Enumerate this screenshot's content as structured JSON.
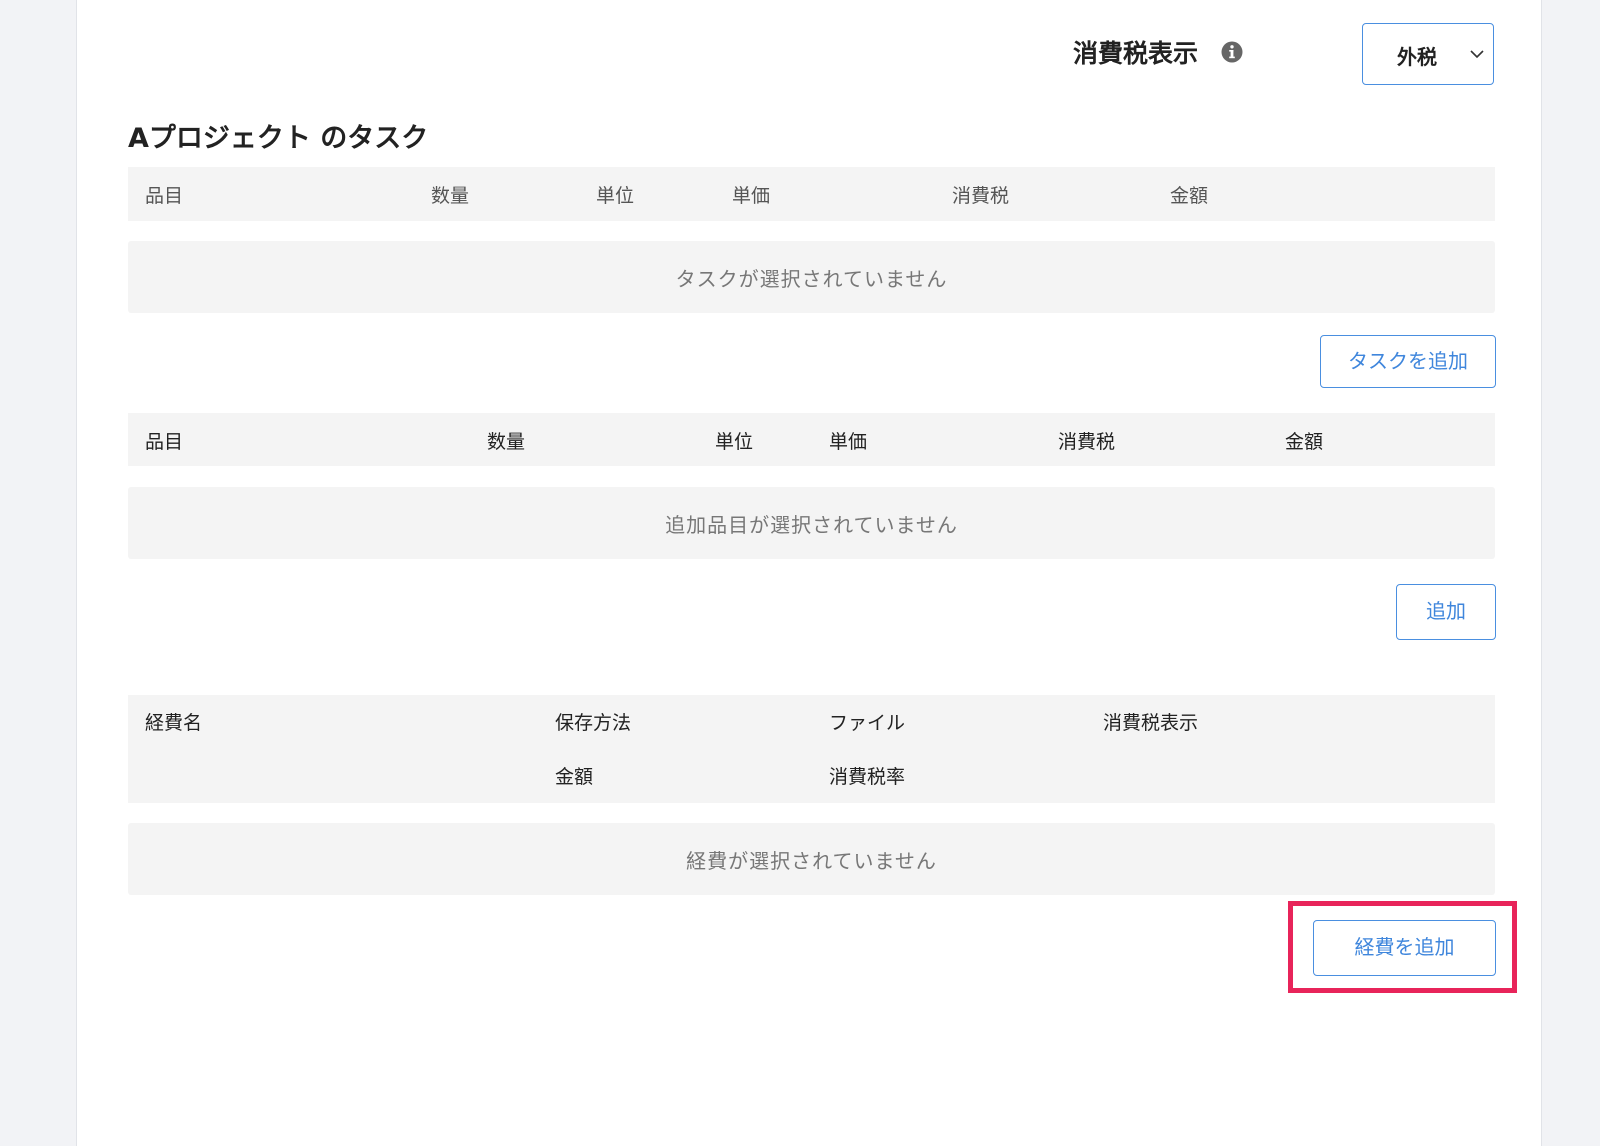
{
  "tax_display": {
    "label": "消費税表示",
    "info_icon": "info-icon",
    "select_value": "外税",
    "select_icon": "chevron-down-icon"
  },
  "task_section": {
    "title": "Aプロジェクト のタスク",
    "columns": [
      "品目",
      "数量",
      "単位",
      "単価",
      "消費税",
      "金額"
    ],
    "empty_message": "タスクが選択されていません",
    "add_button_label": "タスクを追加"
  },
  "item_section": {
    "columns": [
      "品目",
      "数量",
      "単位",
      "単価",
      "消費税",
      "金額"
    ],
    "empty_message": "追加品目が選択されていません",
    "add_button_label": "追加"
  },
  "expense_section": {
    "columns_row1": [
      "経費名",
      "保存方法",
      "ファイル",
      "消費税表示"
    ],
    "columns_row2": [
      "金額",
      "消費税率"
    ],
    "empty_message": "経費が選択されていません",
    "add_button_label": "経費を追加"
  },
  "colors": {
    "accent": "#4a8fe0",
    "highlight": "#e8245a",
    "header_bg": "#f4f4f4",
    "page_bg": "#f2f3f6"
  }
}
